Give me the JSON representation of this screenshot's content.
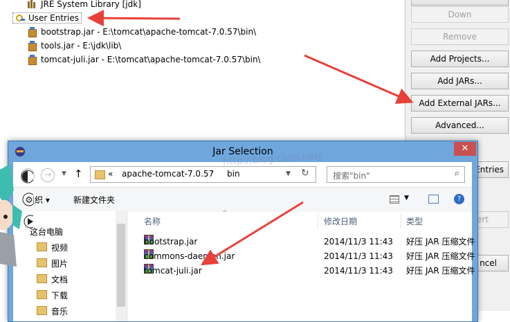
{
  "tree": {
    "jre_label": "JRE System Library [jdk]",
    "user_entries_label": "User Entries",
    "entries": [
      "bootstrap.jar - E:\\tomcat\\apache-tomcat-7.0.57\\bin\\",
      "tools.jar - E:\\jdk\\lib\\",
      "tomcat-juli.jar - E:\\tomcat\\apache-tomcat-7.0.57\\bin\\"
    ]
  },
  "buttons": {
    "down": "Down",
    "remove": "Remove",
    "add_projects": "Add Projects...",
    "add_jars": "Add JARs...",
    "add_external_jars": "Add External JARs...",
    "advanced": "Advanced...",
    "entries_partial": "Entries",
    "restore_partial": "ert",
    "cancel_partial": "ncel"
  },
  "dialog": {
    "title": "Jar Selection",
    "close_glyph": "✕",
    "breadcrumb": {
      "chevron": "«",
      "parent": "apache-tomcat-7.0.57",
      "current": "bin"
    },
    "search_placeholder": "搜索\"bin\"",
    "toolbar": {
      "organize": "组织 ▾",
      "new_folder": "新建文件夹"
    },
    "nav": [
      "这台电脑",
      "视频",
      "图片",
      "文档",
      "下载",
      "音乐"
    ],
    "columns": {
      "name": "名称",
      "modified": "修改日期",
      "type": "类型"
    },
    "files": [
      {
        "name": "bootstrap.jar",
        "date": "2014/11/3 11:43",
        "type": "好压 JAR 压缩文件"
      },
      {
        "name": "commons-daemon.jar",
        "date": "2014/11/3 11:43",
        "type": "好压 JAR 压缩文件"
      },
      {
        "name": "tomcat-juli.jar",
        "date": "2014/11/3 11:43",
        "type": "好压 JAR 压缩文件"
      }
    ]
  },
  "watermark": "http://blog.csdn.net/",
  "colors": {
    "arrow": "#e8403a",
    "dialog_frame": "#6fa6dc",
    "close_button": "#c75050"
  }
}
